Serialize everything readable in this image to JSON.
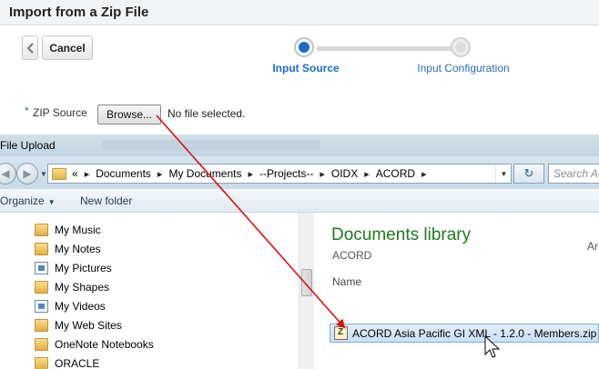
{
  "import_dialog": {
    "title": "Import from a Zip File",
    "cancel_label": "Cancel",
    "steps": [
      {
        "label": "Input Source",
        "state": "current"
      },
      {
        "label": "Input Configuration",
        "state": "upcoming"
      }
    ],
    "zip_required_mark": "*",
    "zip_label": "ZIP Source",
    "browse_label": "Browse...",
    "file_status": "No file selected."
  },
  "upload_dialog": {
    "title": "File Upload",
    "address": {
      "overflow": "«",
      "crumbs": [
        "Documents",
        "My Documents",
        "--Projects--",
        "OIDX",
        "ACORD"
      ]
    },
    "search_placeholder": "Search AC",
    "toolbar": {
      "organize_label": "Organize",
      "new_folder_label": "New folder"
    },
    "nav_items": [
      {
        "label": "My Music",
        "icon": "folder-icon"
      },
      {
        "label": "My Notes",
        "icon": "folder-icon"
      },
      {
        "label": "My Pictures",
        "icon": "library-icon"
      },
      {
        "label": "My Shapes",
        "icon": "folder-icon"
      },
      {
        "label": "My Videos",
        "icon": "library-icon"
      },
      {
        "label": "My Web Sites",
        "icon": "folder-icon"
      },
      {
        "label": "OneNote Notebooks",
        "icon": "folder-icon"
      },
      {
        "label": "ORACLE",
        "icon": "folder-icon"
      }
    ],
    "content": {
      "library_title": "Documents library",
      "library_subtitle": "ACORD",
      "arrange_label": "Ar",
      "name_column": "Name",
      "selected_file": "ACORD Asia Pacific GI XML - 1.2.0 - Members.zip"
    }
  },
  "colors": {
    "accent": "#1a6dcc",
    "library_title": "#1e7a1e",
    "annotation_arrow": "#e01010"
  }
}
